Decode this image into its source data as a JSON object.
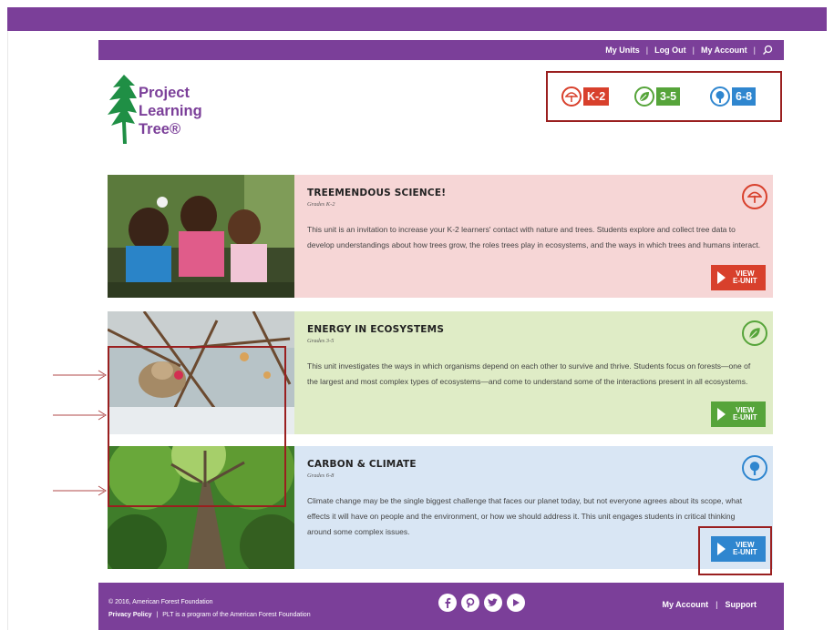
{
  "topnav": {
    "my_units": "My Units",
    "log_out": "Log Out",
    "my_account": "My Account",
    "sep": "|"
  },
  "logo": {
    "line1": "Project",
    "line2": "Learning",
    "line3": "Tree®"
  },
  "grades": [
    {
      "label": "K-2",
      "color": "#d8402c",
      "icon": "umbrella-tree-icon"
    },
    {
      "label": "3-5",
      "color": "#56a43a",
      "icon": "leaf-icon"
    },
    {
      "label": "6-8",
      "color": "#2f86cf",
      "icon": "tree-icon"
    }
  ],
  "units": [
    {
      "title": "TREEMENDOUS SCIENCE!",
      "grades": "Grades K-2",
      "description": "This unit is an invitation to increase your K-2 learners' contact with nature and trees. Students explore and collect tree data to develop understandings about how trees grow, the roles trees play in ecosystems, and the ways in which trees and humans interact.",
      "button": "VIEW E-UNIT",
      "btn_line1": "VIEW",
      "btn_line2": "E-UNIT",
      "color": "#d8402c"
    },
    {
      "title": "ENERGY IN ECOSYSTEMS",
      "grades": "Grades 3-5",
      "description": "This unit investigates the ways in which organisms depend on each other to survive and thrive. Students focus on forests—one of the largest and most complex types of ecosystems—and come to understand some of the interactions present in all ecosystems.",
      "button": "VIEW E-UNIT",
      "btn_line1": "VIEW",
      "btn_line2": "E-UNIT",
      "color": "#56a43a"
    },
    {
      "title": "CARBON & CLIMATE",
      "grades": "Grades 6-8",
      "description": "Climate change may be the single biggest challenge that faces our planet today, but not everyone agrees about its scope, what effects it will have on people and the environment, or how we should address it. This unit engages students in critical thinking around some complex issues.",
      "button": "VIEW E-UNIT",
      "btn_line1": "VIEW",
      "btn_line2": "E-UNIT",
      "color": "#2f86cf"
    }
  ],
  "footer": {
    "copyright": "© 2016, American Forest Foundation",
    "privacy": "Privacy Policy",
    "sep": "|",
    "program": "PLT is a program of the American Forest Foundation",
    "my_account": "My Account",
    "support": "Support",
    "social": [
      "facebook-icon",
      "pinterest-icon",
      "twitter-icon",
      "youtube-icon"
    ]
  },
  "colors": {
    "brand_purple": "#7b3f99",
    "highlight_red": "#9a1f1f"
  }
}
